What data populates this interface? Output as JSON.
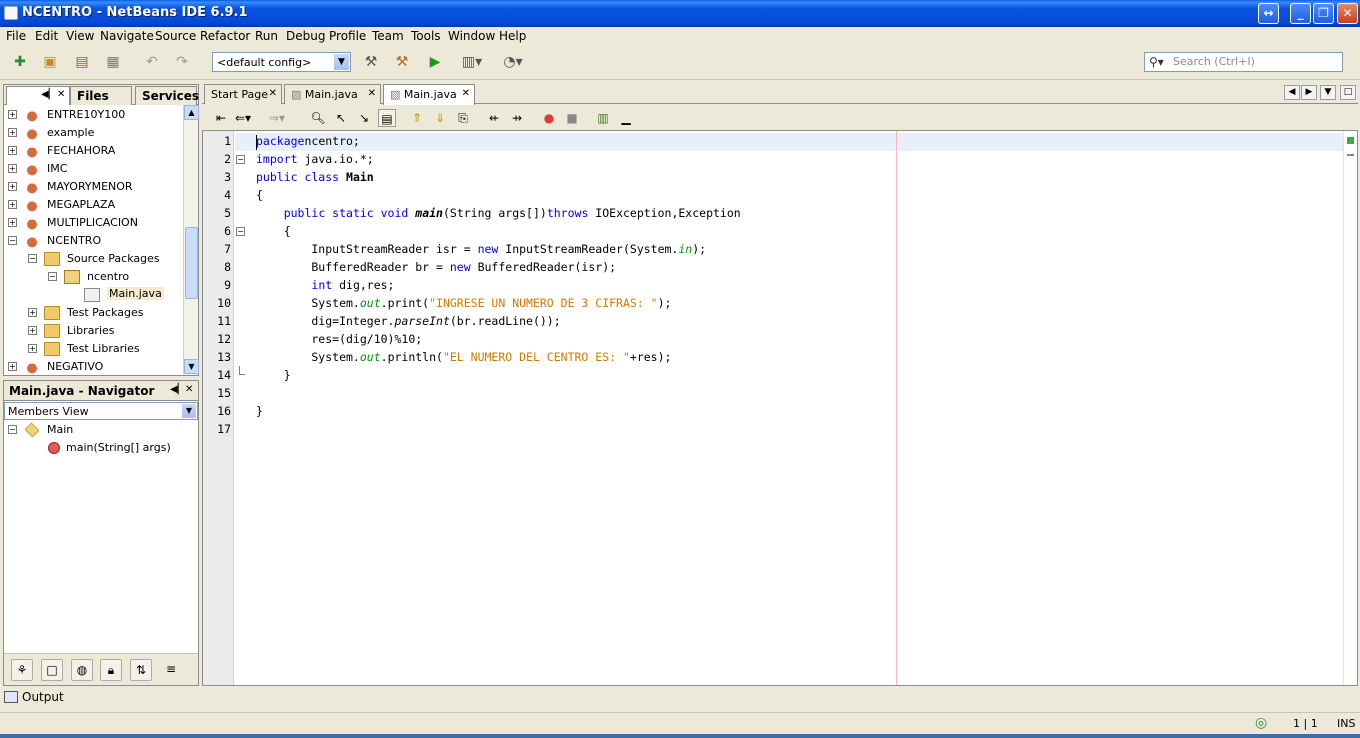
{
  "window": {
    "title": "NCENTRO - NetBeans IDE 6.9.1"
  },
  "menu": [
    "File",
    "Edit",
    "View",
    "Navigate",
    "Source",
    "Refactor",
    "Run",
    "Debug",
    "Profile",
    "Team",
    "Tools",
    "Window",
    "Help"
  ],
  "toolbar": {
    "config_value": "<default config>",
    "search_placeholder": "Search (Ctrl+I)",
    "icons": [
      "new-file-icon",
      "new-project-icon",
      "open-project-icon",
      "save-all-icon",
      "undo-icon",
      "redo-icon",
      "build-icon",
      "clean-build-icon",
      "run-icon",
      "debug-icon",
      "profile-icon"
    ]
  },
  "projects_panel": {
    "tabs": [
      "",
      "Files",
      "Services"
    ],
    "tree": [
      {
        "label": "ENTRE10Y100",
        "level": 0,
        "type": "project",
        "expanded": false
      },
      {
        "label": "example",
        "level": 0,
        "type": "project",
        "expanded": false
      },
      {
        "label": "FECHAHORA",
        "level": 0,
        "type": "project",
        "expanded": false
      },
      {
        "label": "IMC",
        "level": 0,
        "type": "project",
        "expanded": false
      },
      {
        "label": "MAYORYMENOR",
        "level": 0,
        "type": "project",
        "expanded": false
      },
      {
        "label": "MEGAPLAZA",
        "level": 0,
        "type": "project",
        "expanded": false
      },
      {
        "label": "MULTIPLICACION",
        "level": 0,
        "type": "project",
        "expanded": false
      },
      {
        "label": "NCENTRO",
        "level": 0,
        "type": "project",
        "expanded": true
      },
      {
        "label": "Source Packages",
        "level": 1,
        "type": "folder",
        "expanded": true
      },
      {
        "label": "ncentro",
        "level": 2,
        "type": "package",
        "expanded": true
      },
      {
        "label": "Main.java",
        "level": 3,
        "type": "java",
        "selected": true
      },
      {
        "label": "Test Packages",
        "level": 1,
        "type": "folder",
        "expanded": false
      },
      {
        "label": "Libraries",
        "level": 1,
        "type": "folder",
        "expanded": false
      },
      {
        "label": "Test Libraries",
        "level": 1,
        "type": "folder",
        "expanded": false
      },
      {
        "label": "NEGATIVO",
        "level": 0,
        "type": "project",
        "expanded": false
      }
    ]
  },
  "navigator": {
    "title": "Main.java - Navigator",
    "view": "Members View",
    "items": [
      {
        "label": "Main",
        "level": 0
      },
      {
        "label": "main(String[] args)",
        "level": 1
      }
    ]
  },
  "editor": {
    "tabs": [
      {
        "label": "Start Page",
        "active": false
      },
      {
        "label": "Main.java",
        "active": false
      },
      {
        "label": "Main.java",
        "active": true
      }
    ],
    "lines": [
      {
        "n": "1",
        "fold": ""
      },
      {
        "n": "2",
        "fold": "-"
      },
      {
        "n": "3",
        "fold": ""
      },
      {
        "n": "4",
        "fold": ""
      },
      {
        "n": "5",
        "fold": ""
      },
      {
        "n": "6",
        "fold": "-"
      },
      {
        "n": "7",
        "fold": ""
      },
      {
        "n": "8",
        "fold": ""
      },
      {
        "n": "9",
        "fold": ""
      },
      {
        "n": "10",
        "fold": ""
      },
      {
        "n": "11",
        "fold": ""
      },
      {
        "n": "12",
        "fold": ""
      },
      {
        "n": "13",
        "fold": ""
      },
      {
        "n": "14",
        "fold": "end"
      },
      {
        "n": "15",
        "fold": ""
      },
      {
        "n": "16",
        "fold": ""
      },
      {
        "n": "17",
        "fold": ""
      }
    ],
    "code": [
      [
        [
          "kw",
          "package"
        ],
        [
          "",
          "ncentro;"
        ]
      ],
      [
        [
          "kw",
          "import"
        ],
        [
          "",
          " java.io.*;"
        ]
      ],
      [
        [
          "kw",
          "public class"
        ],
        [
          "",
          " "
        ],
        [
          "bold",
          "Main"
        ]
      ],
      [
        [
          "",
          "{"
        ]
      ],
      [
        [
          "",
          "    "
        ],
        [
          "kw",
          "public static void"
        ],
        [
          "",
          " "
        ],
        [
          "bold ital",
          "main"
        ],
        [
          "",
          "(String args[])"
        ],
        [
          "kw",
          "throws"
        ],
        [
          "",
          " IOException,Exception"
        ]
      ],
      [
        [
          "",
          "    {"
        ]
      ],
      [
        [
          "",
          "        InputStreamReader isr = "
        ],
        [
          "kw",
          "new"
        ],
        [
          "",
          " InputStreamReader(System."
        ],
        [
          "fld",
          "in"
        ],
        [
          "",
          ");"
        ]
      ],
      [
        [
          "",
          "        BufferedReader br = "
        ],
        [
          "kw",
          "new"
        ],
        [
          "",
          " BufferedReader(isr);"
        ]
      ],
      [
        [
          "",
          "        "
        ],
        [
          "kw",
          "int"
        ],
        [
          "",
          " dig,res;"
        ]
      ],
      [
        [
          "",
          "        System."
        ],
        [
          "fld",
          "out"
        ],
        [
          "",
          ".print("
        ],
        [
          "str",
          "\"INGRESE UN NUMERO DE 3 CIFRAS: \""
        ],
        [
          "",
          ");"
        ]
      ],
      [
        [
          "",
          "        dig=Integer."
        ],
        [
          "ital",
          "parseInt"
        ],
        [
          "",
          "(br.readLine());"
        ]
      ],
      [
        [
          "",
          "        res=(dig/10)%10;"
        ]
      ],
      [
        [
          "",
          "        System."
        ],
        [
          "fld",
          "out"
        ],
        [
          "",
          ".println("
        ],
        [
          "str",
          "\"EL NUMERO DEL CENTRO ES: \""
        ],
        [
          "",
          "+res);"
        ]
      ],
      [
        [
          "",
          "    }"
        ]
      ],
      [
        [
          "",
          ""
        ]
      ],
      [
        [
          "",
          "}"
        ]
      ],
      [
        [
          "",
          ""
        ]
      ]
    ]
  },
  "output": {
    "label": "Output"
  },
  "status": {
    "position": "1 | 1",
    "mode": "INS"
  }
}
